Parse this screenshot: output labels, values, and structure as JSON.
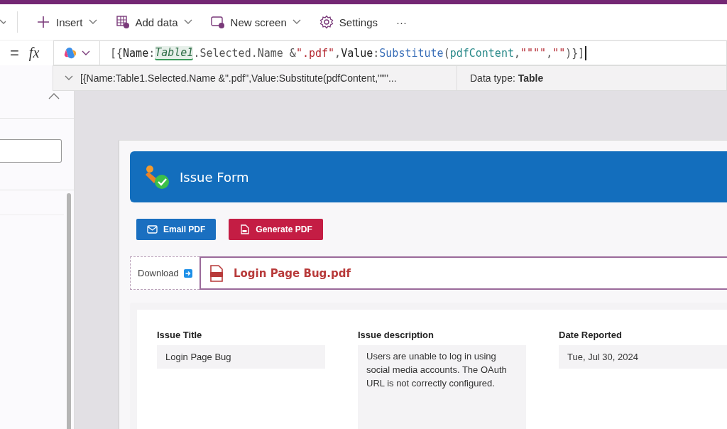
{
  "toolbar": {
    "items": [
      {
        "label": "Insert",
        "kind": "insert"
      },
      {
        "label": "Add data",
        "kind": "data"
      },
      {
        "label": "New screen",
        "kind": "screen"
      },
      {
        "label": "Settings",
        "kind": "settings"
      },
      {
        "label": "···",
        "kind": "more"
      }
    ]
  },
  "formula_bar": {
    "equals": "=",
    "fx": "fx",
    "tokens": [
      {
        "text": "[{",
        "kind": "punct"
      },
      {
        "text": "Name",
        "kind": "plain"
      },
      {
        "text": ":",
        "kind": "punct"
      },
      {
        "text": "Table1",
        "kind": "table"
      },
      {
        "text": ".Selected.Name &",
        "kind": "punct"
      },
      {
        "text": "\".pdf\"",
        "kind": "string"
      },
      {
        "text": ",",
        "kind": "punct"
      },
      {
        "text": "Value",
        "kind": "plain"
      },
      {
        "text": ":",
        "kind": "punct"
      },
      {
        "text": "Substitute",
        "kind": "function"
      },
      {
        "text": "(",
        "kind": "punct"
      },
      {
        "text": "pdfContent",
        "kind": "variable"
      },
      {
        "text": ",",
        "kind": "punct"
      },
      {
        "text": "\"\"\"\"",
        "kind": "string"
      },
      {
        "text": ",",
        "kind": "punct"
      },
      {
        "text": "\"\"",
        "kind": "string"
      },
      {
        "text": ")}]",
        "kind": "punct"
      }
    ]
  },
  "result": {
    "expression": "[{Name:Table1.Selected.Name &\".pdf\",Value:Substitute(pdfContent,\"\"\"...",
    "data_type": "Data type: **Table**"
  },
  "form": {
    "title": "Issue Form",
    "buttons": [
      {
        "label": "Email PDF",
        "kind": "email"
      },
      {
        "label": "Generate PDF",
        "kind": "generate"
      }
    ],
    "download": {
      "label": "Download",
      "file": "Login Page Bug.pdf"
    },
    "fields": [
      {
        "label": "Issue Title",
        "value": "Login Page Bug",
        "kind": "single"
      },
      {
        "label": "Issue description",
        "value": "Users are unable to log in using social media accounts. The OAuth URL is not correctly configured.",
        "kind": "multi"
      },
      {
        "label": "Date Reported",
        "value": "Tue, Jul 30, 2024",
        "kind": "single"
      }
    ]
  }
}
